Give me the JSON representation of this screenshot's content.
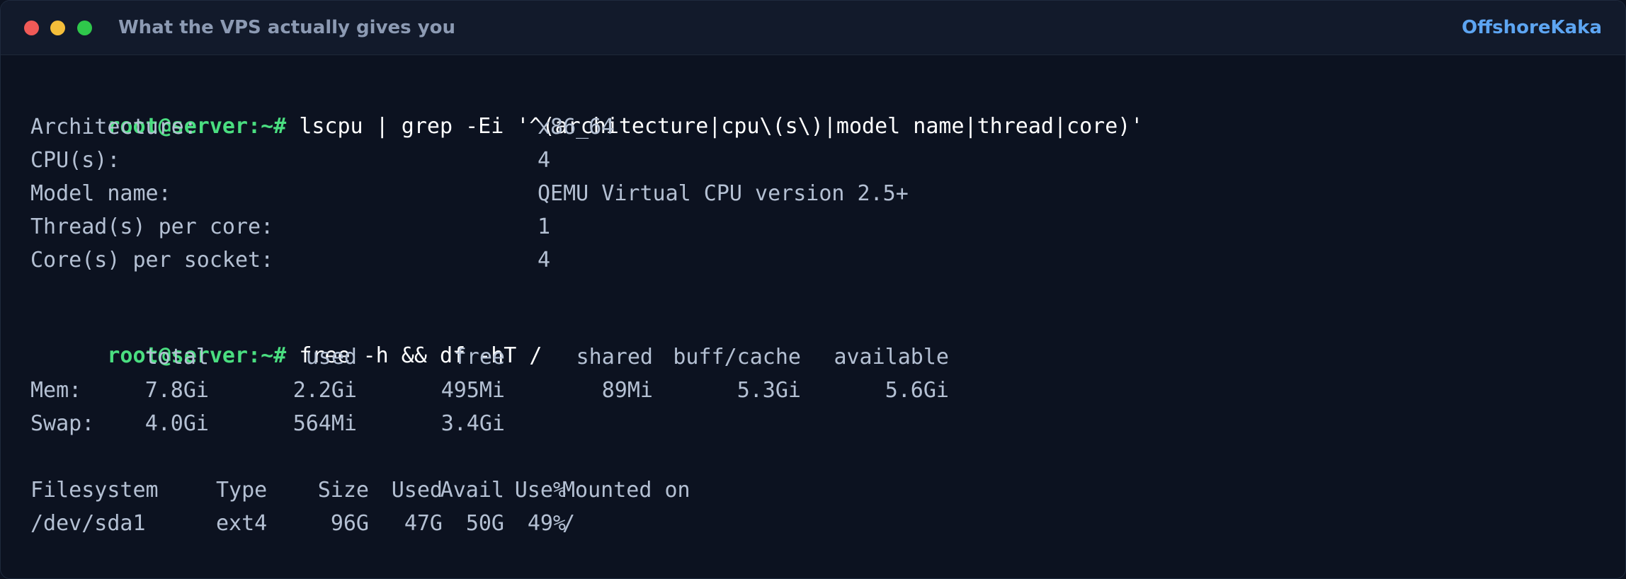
{
  "window": {
    "title": "What the VPS actually gives you",
    "brand": "OffshoreKaka"
  },
  "terminal": {
    "prompt": "root@server:~#",
    "command1": "lscpu | grep -Ei '^(architecture|cpu\\(s\\)|model name|thread|core)'",
    "lscpu": [
      {
        "key": "Architecture:",
        "value": "x86_64"
      },
      {
        "key": "CPU(s):",
        "value": "4"
      },
      {
        "key": "Model name:",
        "value": "QEMU Virtual CPU version 2.5+"
      },
      {
        "key": "Thread(s) per core:",
        "value": "1"
      },
      {
        "key": "Core(s) per socket:",
        "value": "4"
      }
    ],
    "command2": "free -h && df -hT /",
    "free": {
      "headers": [
        "total",
        "used",
        "free",
        "shared",
        "buff/cache",
        "available"
      ],
      "rows": [
        {
          "label": "Mem:",
          "cells": [
            "7.8Gi",
            "2.2Gi",
            "495Mi",
            "89Mi",
            "5.3Gi",
            "5.6Gi"
          ]
        },
        {
          "label": "Swap:",
          "cells": [
            "4.0Gi",
            "564Mi",
            "3.4Gi",
            "",
            "",
            ""
          ]
        }
      ]
    },
    "df": {
      "headers": [
        "Filesystem",
        "Type",
        "Size",
        "Used",
        "Avail",
        "Use%",
        "Mounted on"
      ],
      "rows": [
        {
          "cells": [
            "/dev/sda1",
            "ext4",
            "96G",
            "47G",
            "50G",
            "49%",
            "/"
          ]
        }
      ]
    }
  },
  "colors": {
    "background": "#0c1220",
    "titlebar": "#121a2b",
    "prompt": "#4ade80",
    "brand": "#5da5f2",
    "output_text": "#b4c0d3",
    "close_dot": "#f05a57",
    "minimize_dot": "#f4be3a",
    "maximize_dot": "#2fc84b"
  }
}
